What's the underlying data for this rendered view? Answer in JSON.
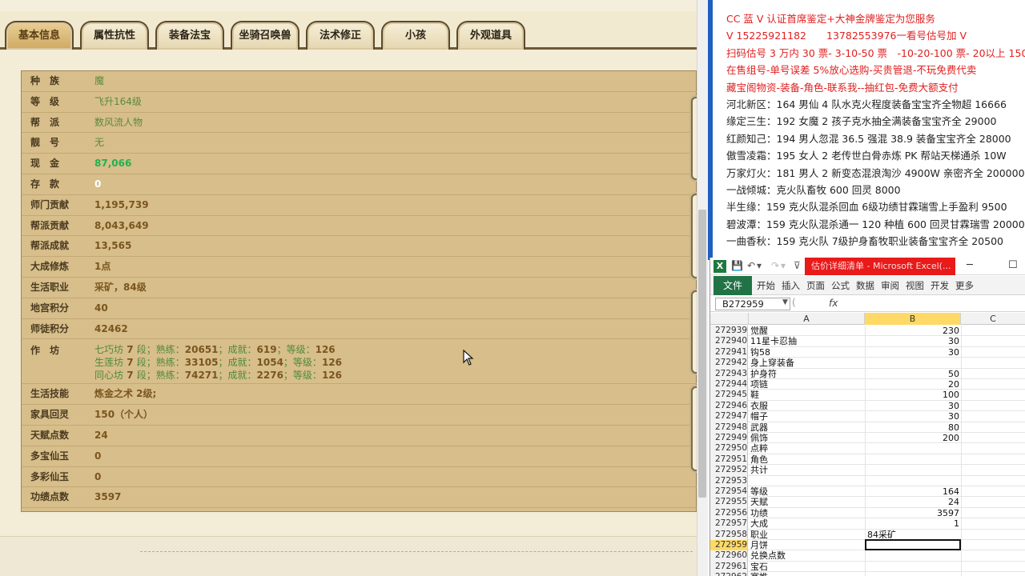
{
  "tabs": [
    "基本信息",
    "属性抗性",
    "装备法宝",
    "坐骑召唤兽",
    "法术修正",
    "小孩",
    "外观道具"
  ],
  "rows": [
    {
      "label": "种　族",
      "value": "魔",
      "style": "green"
    },
    {
      "label": "等　级",
      "value": "飞升164级",
      "style": "green"
    },
    {
      "label": "帮　派",
      "value": "数风流人物",
      "style": "green"
    },
    {
      "label": "靓　号",
      "value": "无",
      "style": "green"
    },
    {
      "label": "现　金",
      "value": "87,066",
      "style": "bright"
    },
    {
      "label": "存　款",
      "value": "0",
      "style": "white"
    },
    {
      "label": "师门贡献",
      "value": "1,195,739",
      "style": "brown"
    },
    {
      "label": "帮派贡献",
      "value": "8,043,649",
      "style": "brown"
    },
    {
      "label": "帮派成就",
      "value": "13,565",
      "style": "brown"
    },
    {
      "label": "大成修炼",
      "value": "1点",
      "style": "brown"
    },
    {
      "label": "生活职业",
      "value": "采矿，84级",
      "style": "brown"
    },
    {
      "label": "地宫积分",
      "value": "40",
      "style": "brown"
    },
    {
      "label": "师徒积分",
      "value": "42462",
      "style": "brown"
    }
  ],
  "workshop": {
    "label": "作　坊",
    "lines": [
      {
        "name": "七巧坊",
        "level": "7",
        "prof": "20651",
        "ach": "619",
        "grade": "126"
      },
      {
        "name": "生莲坊",
        "level": "7",
        "prof": "33105",
        "ach": "1054",
        "grade": "126"
      },
      {
        "name": "同心坊",
        "level": "7",
        "prof": "74271",
        "ach": "2276",
        "grade": "126"
      }
    ],
    "w_seg": "段；熟练：",
    "w_ach": "；成就：",
    "w_grade": "；等级："
  },
  "rows2": [
    {
      "label": "生活技能",
      "value": "炼金之术 2级;",
      "style": "brown"
    },
    {
      "label": "家具回灵",
      "value": "150（个人）",
      "style": "brown"
    },
    {
      "label": "天赋点数",
      "value": "24",
      "style": "brown"
    },
    {
      "label": "多宝仙玉",
      "value": "0",
      "style": "brown"
    },
    {
      "label": "多彩仙玉",
      "value": "0",
      "style": "brown"
    },
    {
      "label": "功绩点数",
      "value": "3597",
      "style": "brown"
    }
  ],
  "side_buttons": [
    {
      "chars": [
        "我",
        "的",
        "收",
        "藏"
      ]
    },
    {
      "chars": [
        "足",
        "迹"
      ]
    },
    {
      "chars": [
        "我",
        "的",
        "还",
        "价"
      ]
    },
    {
      "chars": [
        "返",
        "回",
        "顶",
        "部"
      ]
    }
  ],
  "doc_lines": [
    {
      "text": "CC 蓝 V 认证首席鉴定+大神金牌鉴定为您服务",
      "color": "red"
    },
    {
      "text": "V 15225921182　　13782553976一看号估号加 V",
      "color": "red"
    },
    {
      "text": "扫码估号 3 万内 30 票- 3-10-50 票　-10-20-100 票- 20以上 150",
      "color": "red"
    },
    {
      "text": "在售组号-单号误差 5%放心选购-买贵管退-不玩免费代卖",
      "color": "red"
    },
    {
      "text": "藏宝阁物资-装备-角色-联系我--抽红包-免费大额支付",
      "color": "red"
    },
    {
      "text": "河北新区：164 男仙 4 队水克火程度装备宝宝齐全物超 16666",
      "color": "black"
    },
    {
      "text": "缘定三生：192 女魔 2 孩子克水抽全满装备宝宝齐全 29000",
      "color": "black"
    },
    {
      "text": "红颜知己：194 男人忽混 36.5 强混 38.9 装备宝宝齐全 28000",
      "color": "black"
    },
    {
      "text": "傲雪凌霜：195 女人 2 老传世白骨赤炼 PK 帮站天梯通杀 10W",
      "color": "black"
    },
    {
      "text": "万家灯火：181 男人 2 新变态混浪淘沙 4900W 亲密齐全 200000",
      "color": "black"
    },
    {
      "text": "一战倾城：克火队畜牧 600 回灵 8000",
      "color": "black"
    },
    {
      "text": "半生缘：159 克火队混杀回血 6级功绩甘霖瑞雪上手盈利 9500",
      "color": "black"
    },
    {
      "text": "碧波潭：159 克火队混杀通一 120 种植 600 回灵甘霖瑞雪 20000",
      "color": "black"
    },
    {
      "text": "一曲香秋：159 克火队 7级护身畜牧职业装备宝宝齐全 20500",
      "color": "black"
    }
  ],
  "excel": {
    "title": "估价详细清单 - Microsoft Excel(...",
    "ribbon_file": "文件",
    "ribbon_tabs": [
      "开始",
      "插入",
      "页面",
      "公式",
      "数据",
      "审阅",
      "视图",
      "开发",
      "更多"
    ],
    "namebox": "B272959",
    "fx": "fx",
    "columns": [
      "A",
      "B",
      "C"
    ],
    "rows": [
      {
        "n": "272939",
        "a": "觉醒",
        "b": "230"
      },
      {
        "n": "272940",
        "a": "11星卡忍抽",
        "b": "30"
      },
      {
        "n": "272941",
        "a": "钩58",
        "b": "30"
      },
      {
        "n": "272942",
        "a": "身上穿装备",
        "b": ""
      },
      {
        "n": "272943",
        "a": "护身符",
        "b": "50"
      },
      {
        "n": "272944",
        "a": "项链",
        "b": "20"
      },
      {
        "n": "272945",
        "a": "鞋",
        "b": "100"
      },
      {
        "n": "272946",
        "a": "衣服",
        "b": "30"
      },
      {
        "n": "272947",
        "a": "帽子",
        "b": "30"
      },
      {
        "n": "272948",
        "a": "武器",
        "b": "80"
      },
      {
        "n": "272949",
        "a": "佩饰",
        "b": "200"
      },
      {
        "n": "272950",
        "a": "点粹",
        "b": ""
      },
      {
        "n": "272951",
        "a": "角色",
        "b": ""
      },
      {
        "n": "272952",
        "a": "共计",
        "b": ""
      },
      {
        "n": "272953",
        "a": "",
        "b": ""
      },
      {
        "n": "272954",
        "a": "等级",
        "b": "164"
      },
      {
        "n": "272955",
        "a": "天赋",
        "b": "24"
      },
      {
        "n": "272956",
        "a": "功绩",
        "b": "3597"
      },
      {
        "n": "272957",
        "a": "大成",
        "b": "1"
      },
      {
        "n": "272958",
        "a": "职业",
        "b": "84采矿",
        "btext": true
      },
      {
        "n": "272959",
        "a": "月饼",
        "b": "",
        "selected": true
      },
      {
        "n": "272960",
        "a": "兑换点数",
        "b": ""
      },
      {
        "n": "272961",
        "a": "宝石",
        "b": ""
      },
      {
        "n": "272962",
        "a": "赛推",
        "b": ""
      }
    ]
  }
}
